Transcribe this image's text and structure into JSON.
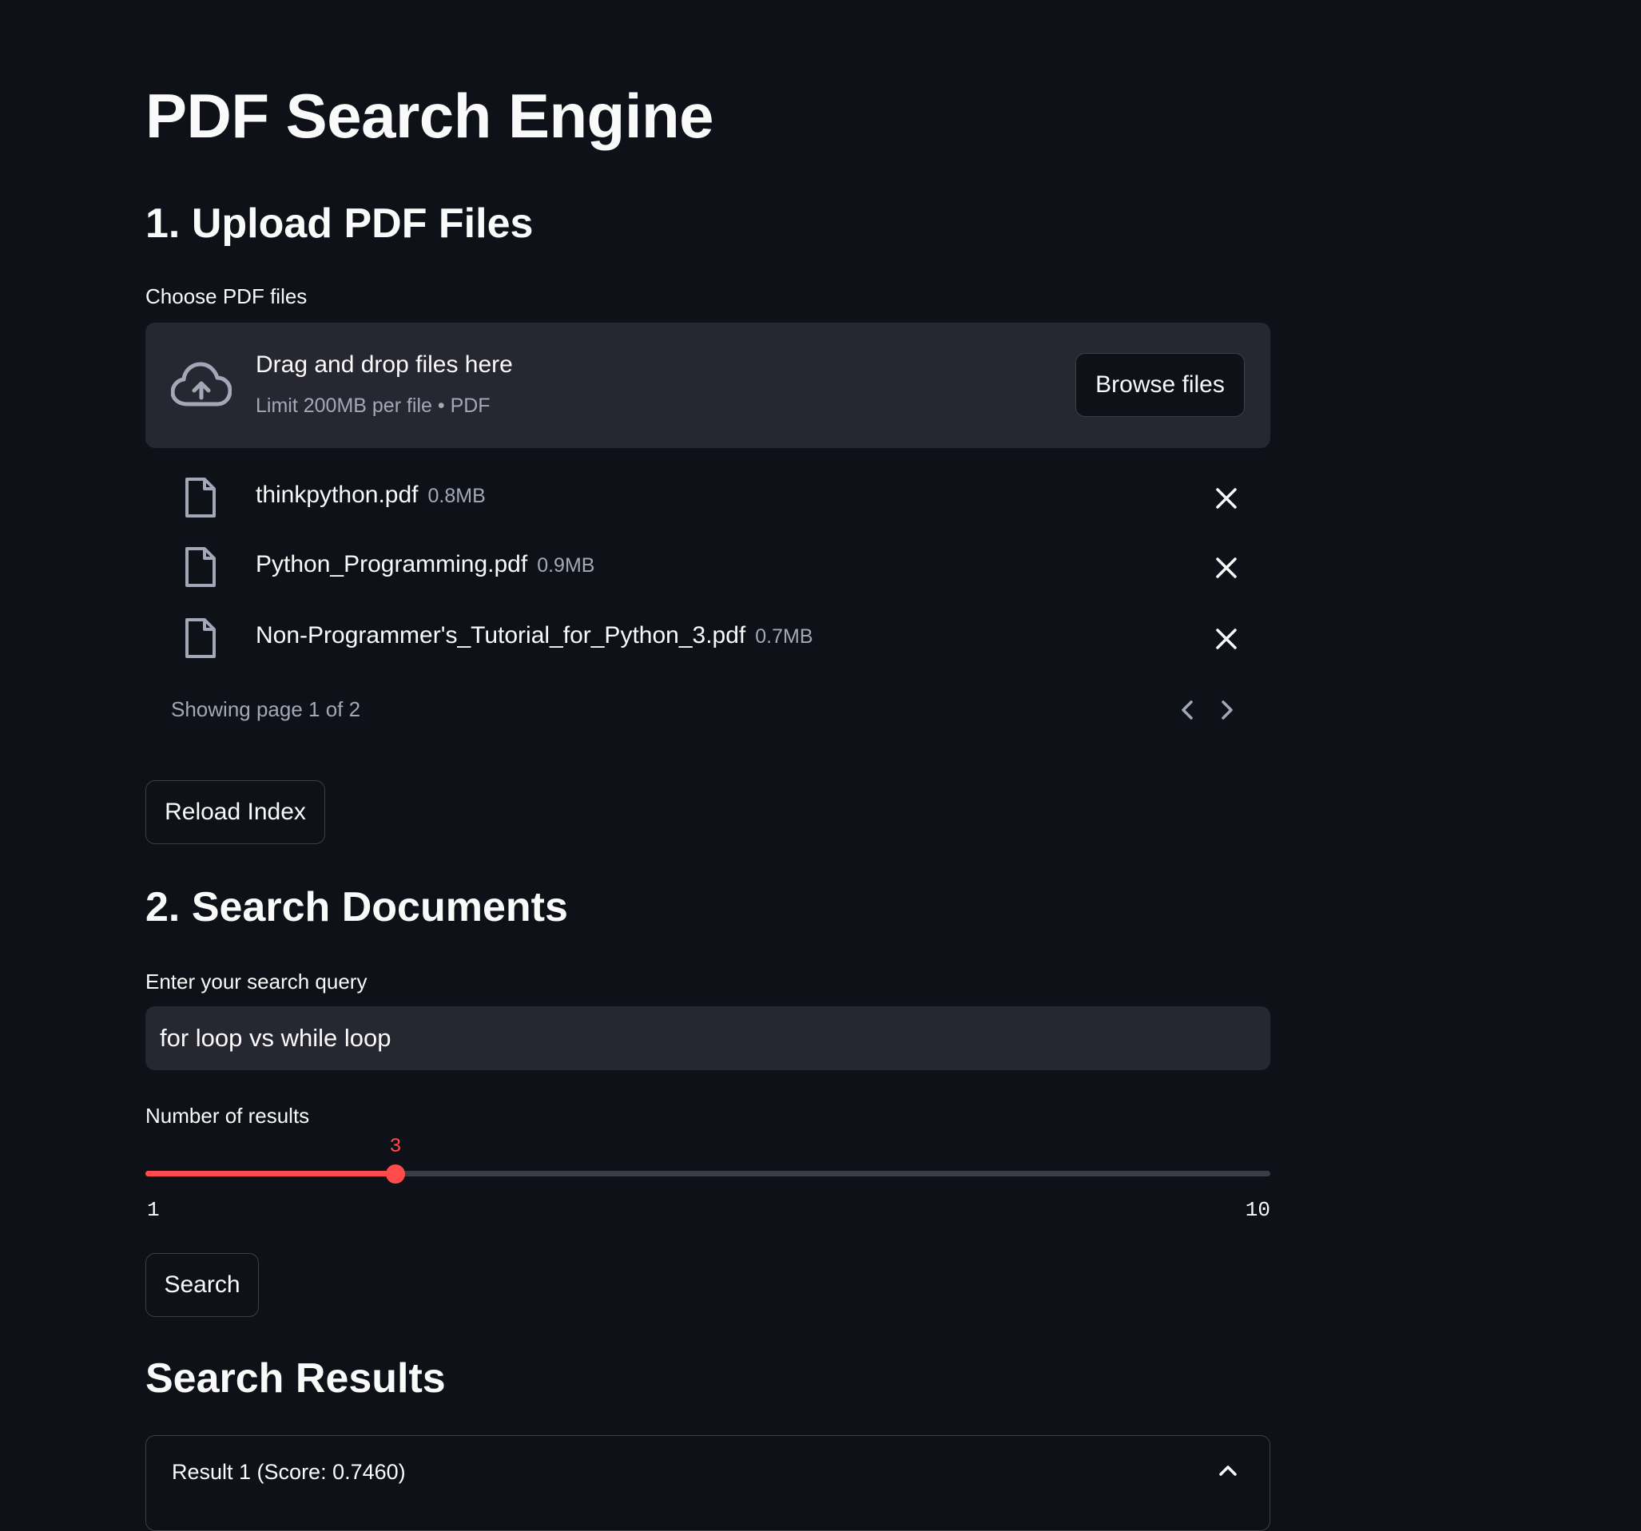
{
  "page": {
    "title": "PDF Search Engine"
  },
  "upload": {
    "heading": "1. Upload PDF Files",
    "label": "Choose PDF files",
    "dropzone_title": "Drag and drop files here",
    "dropzone_sub": "Limit 200MB per file • PDF",
    "browse_label": "Browse files",
    "files": [
      {
        "name": "thinkpython.pdf",
        "size": "0.8MB"
      },
      {
        "name": "Python_Programming.pdf",
        "size": "0.9MB"
      },
      {
        "name": "Non-Programmer's_Tutorial_for_Python_3.pdf",
        "size": "0.7MB"
      }
    ],
    "pager_text": "Showing page 1 of 2",
    "reload_label": "Reload Index"
  },
  "search": {
    "heading": "2. Search Documents",
    "query_label": "Enter your search query",
    "query_value": "for loop vs while loop",
    "results_label": "Number of results",
    "slider": {
      "value": 3,
      "min": 1,
      "max": 10,
      "value_text": "3",
      "min_text": "1",
      "max_text": "10"
    },
    "search_label": "Search"
  },
  "results": {
    "heading": "Search Results",
    "items": [
      {
        "title": "Result 1 (Score: 0.7460)"
      }
    ]
  },
  "colors": {
    "background": "#0e1117",
    "surface": "#262730",
    "accent": "#ff4b4b",
    "text": "#fafafa",
    "muted": "#a3a8b8"
  },
  "icons": {
    "upload": "cloud-upload-icon",
    "file": "file-icon",
    "remove": "close-icon",
    "prev": "chevron-left-icon",
    "next": "chevron-right-icon",
    "collapse": "chevron-up-icon"
  }
}
